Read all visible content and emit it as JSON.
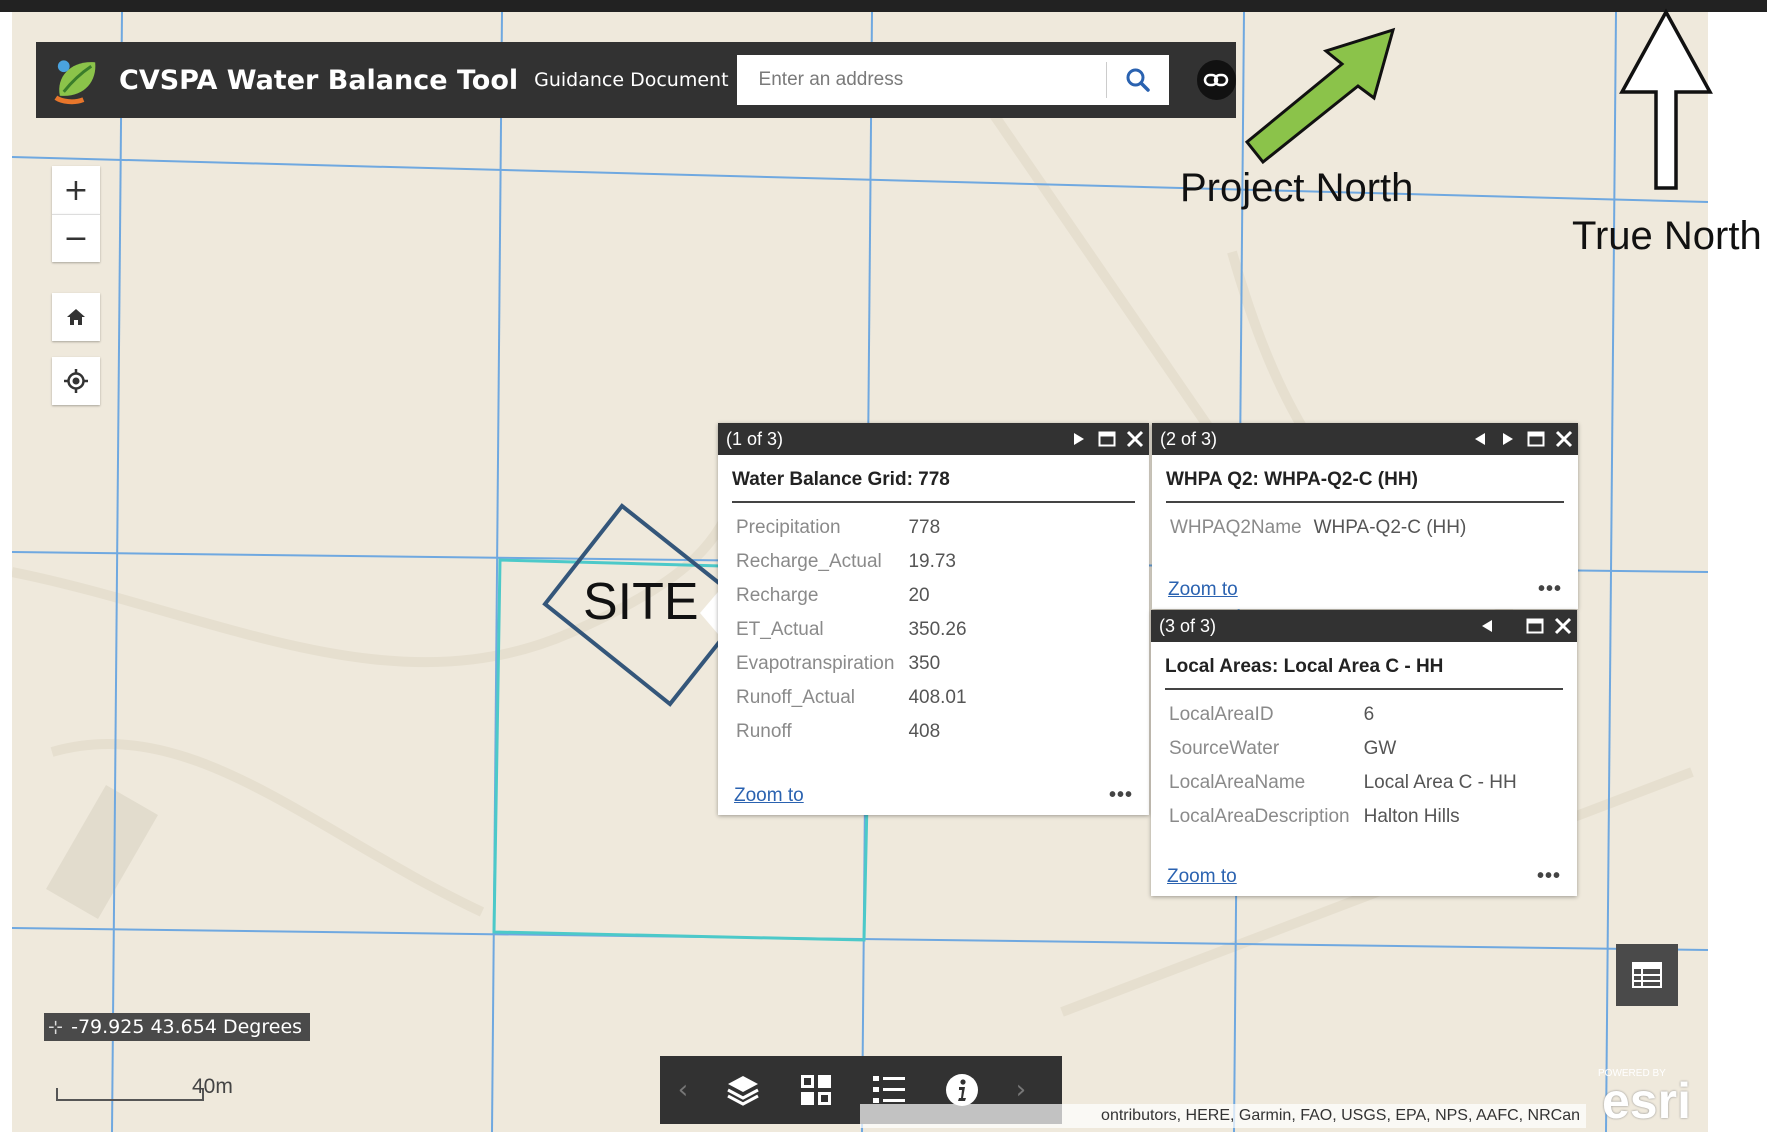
{
  "header": {
    "title": "CVSPA Water Balance Tool",
    "guidance_link": "Guidance Document",
    "search_placeholder": "Enter an address"
  },
  "map_controls": {
    "zoom_in": "+",
    "zoom_out": "−"
  },
  "annotations": {
    "project_north": "Project North",
    "true_north": "True North",
    "site": "SITE"
  },
  "popups": [
    {
      "count": "(1 of 3)",
      "title": "Water Balance Grid: 778",
      "fields": [
        {
          "key": "Precipitation",
          "value": "778"
        },
        {
          "key": "Recharge_Actual",
          "value": "19.73"
        },
        {
          "key": "Recharge",
          "value": "20"
        },
        {
          "key": "ET_Actual",
          "value": "350.26"
        },
        {
          "key": "Evapotranspiration",
          "value": "350"
        },
        {
          "key": "Runoff_Actual",
          "value": "408.01"
        },
        {
          "key": "Runoff",
          "value": "408"
        }
      ],
      "zoom_label": "Zoom to",
      "menu": "•••"
    },
    {
      "count": "(2 of 3)",
      "title": "WHPA Q2: WHPA-Q2-C (HH)",
      "fields": [
        {
          "key": "WHPAQ2Name",
          "value": "WHPA-Q2-C (HH)"
        }
      ],
      "zoom_label": "Zoom to",
      "menu": "•••"
    },
    {
      "count": "(3 of 3)",
      "title": "Local Areas: Local Area C - HH",
      "fields": [
        {
          "key": "LocalAreaID",
          "value": "6"
        },
        {
          "key": "SourceWater",
          "value": "GW"
        },
        {
          "key": "LocalAreaName",
          "value": "Local Area C - HH"
        },
        {
          "key": "LocalAreaDescription",
          "value": "Halton Hills"
        }
      ],
      "zoom_label": "Zoom to",
      "menu": "•••"
    }
  ],
  "coordinates": "-79.925 43.654 Degrees",
  "scale": "40m",
  "toolbar": {
    "prev": "‹",
    "next": "›",
    "icons": [
      "layers-icon",
      "basemap-gallery-icon",
      "legend-icon",
      "info-icon"
    ]
  },
  "attribution": "ontributors, HERE, Garmin, FAO, USGS, EPA, NPS, AAFC, NRCan",
  "esri": {
    "powered": "POWERED BY",
    "word": "esri"
  },
  "colors": {
    "header_bg": "#323232",
    "grid_line": "#6fa8e0",
    "site_cell": "#4cc9c9",
    "project_north_arrow": "#8bc34a",
    "site_diamond": "#34567a",
    "link": "#2a62b0"
  }
}
